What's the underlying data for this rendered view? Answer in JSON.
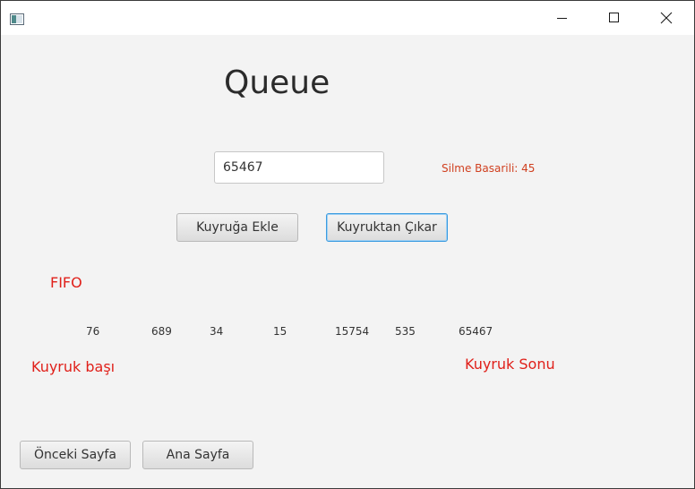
{
  "window": {
    "title": "",
    "icon": "java-app-icon",
    "controls": [
      "minimize-icon",
      "maximize-icon",
      "close-icon"
    ]
  },
  "page": {
    "title": "Queue"
  },
  "input": {
    "value": "65467"
  },
  "status": {
    "text": "Silme Basarili: 45",
    "color": "#d04020"
  },
  "buttons": {
    "enqueue": "Kuyruğa Ekle",
    "dequeue": "Kuyruktan Çıkar",
    "previous_page": "Önceki Sayfa",
    "home_page": "Ana Sayfa"
  },
  "queue": {
    "mode_label": "FIFO",
    "values": [
      "76",
      "689",
      "34",
      "15",
      "15754",
      "535",
      "65467"
    ],
    "head_label": "Kuyruk başı",
    "tail_label": "Kuyruk Sonu",
    "label_color": "#e0201a"
  }
}
